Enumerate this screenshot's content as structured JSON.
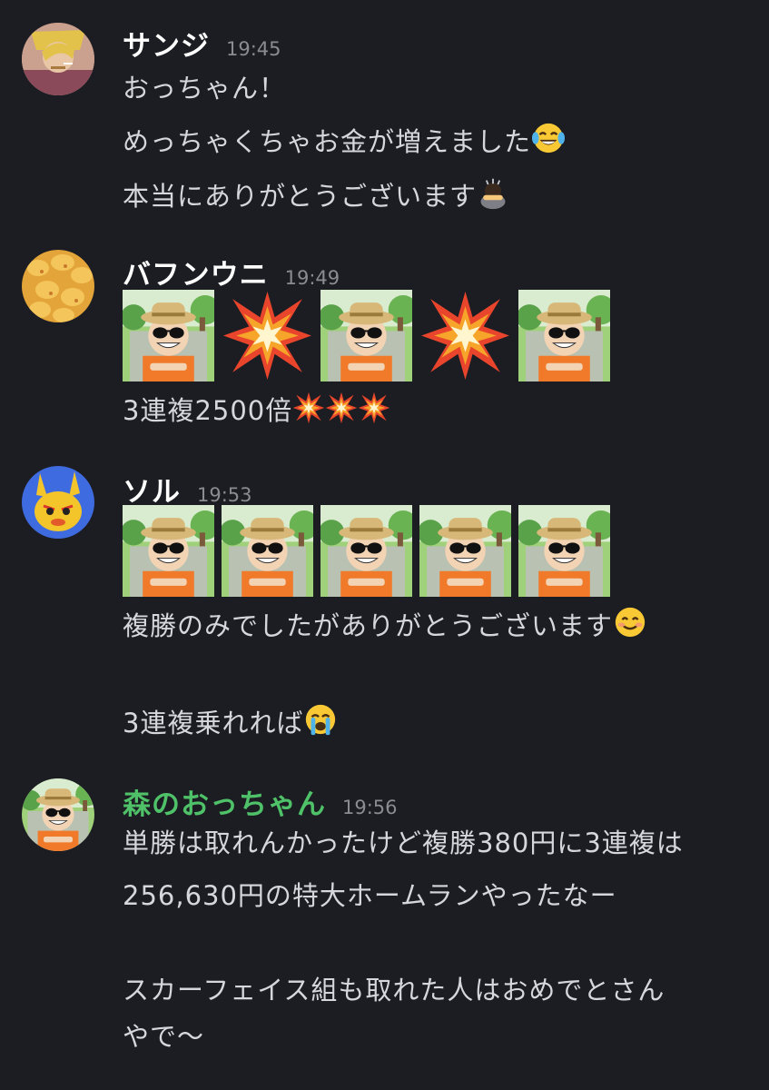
{
  "messages": [
    {
      "author": "サンジ",
      "time": "19:45",
      "lines": [
        "おっちゃん！",
        "めっちゃくちゃお金が増えました",
        "本当にありがとうございます"
      ]
    },
    {
      "author": "バフンウニ",
      "time": "19:49",
      "lines": [
        "3連複2500倍"
      ]
    },
    {
      "author": "ソル",
      "time": "19:53",
      "lines": [
        "複勝のみでしたがありがとうございます",
        "3連複乗れれば"
      ]
    },
    {
      "author": "森のおっちゃん",
      "time": "19:56",
      "lines": [
        "単勝は取れんかったけど複勝380円に3連複は",
        "256,630円の特大ホームランやったなー",
        "スカーフェイス組も取れた人はおめでとさん",
        "やで〜"
      ]
    }
  ],
  "colors": {
    "background": "#1c1d22",
    "author_name": "#ffffff",
    "owner_name": "#4fc269",
    "timestamp": "#8a8c93",
    "text": "#d6d7dc"
  }
}
